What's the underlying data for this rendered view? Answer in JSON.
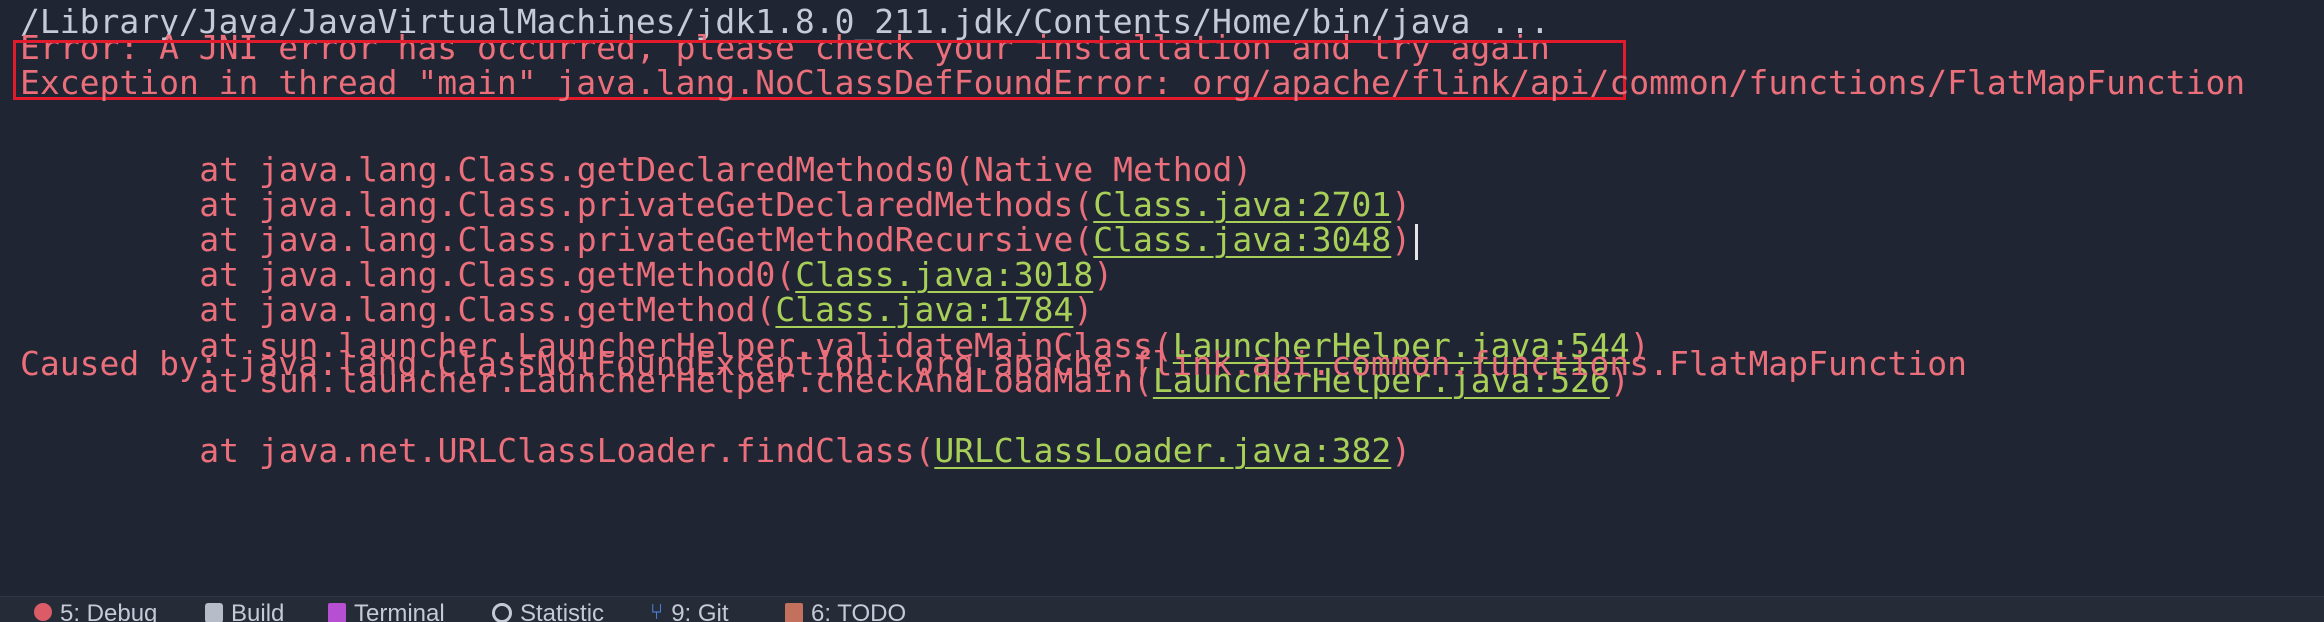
{
  "console": {
    "command_line": "/Library/Java/JavaVirtualMachines/jdk1.8.0_211.jdk/Contents/Home/bin/java ...",
    "error_line": "Error: A JNI error has occurred, please check your installation and try again",
    "exception_line": "Exception in thread \"main\" java.lang.NoClassDefFoundError: org/apache/flink/api/common/functions/FlatMapFunction",
    "frames": [
      {
        "prefix": "at java.lang.Class.getDeclaredMethods0(Native Method)",
        "link": "",
        "suffix": ""
      },
      {
        "prefix": "at java.lang.Class.privateGetDeclaredMethods(",
        "link": "Class.java:2701",
        "suffix": ")"
      },
      {
        "prefix": "at java.lang.Class.privateGetMethodRecursive(",
        "link": "Class.java:3048",
        "suffix": ")"
      },
      {
        "prefix": "at java.lang.Class.getMethod0(",
        "link": "Class.java:3018",
        "suffix": ")"
      },
      {
        "prefix": "at java.lang.Class.getMethod(",
        "link": "Class.java:1784",
        "suffix": ")"
      },
      {
        "prefix": "at sun.launcher.LauncherHelper.validateMainClass(",
        "link": "LauncherHelper.java:544",
        "suffix": ")"
      },
      {
        "prefix": "at sun.launcher.LauncherHelper.checkAndLoadMain(",
        "link": "LauncherHelper.java:526",
        "suffix": ")"
      }
    ],
    "caused_by_line": "Caused by: java.lang.ClassNotFoundException: org.apache.flink.api.common.functions.FlatMapFunction",
    "partial_frame": {
      "prefix": "at java.net.URLClassLoader.findClass(",
      "link": "URLClassLoader.java:382",
      "suffix": ")"
    }
  },
  "statusbar": {
    "tools": [
      {
        "label": "5: Debug",
        "icon": "debug-icon"
      },
      {
        "label": "Build",
        "icon": "build-icon"
      },
      {
        "label": "Terminal",
        "icon": "terminal-icon"
      },
      {
        "label": "Statistic",
        "icon": "statistic-icon"
      },
      {
        "label": "9: Git",
        "icon": "git-icon"
      },
      {
        "label": "6: TODO",
        "icon": "todo-icon"
      }
    ]
  },
  "colors": {
    "background": "#1f2533",
    "error_text": "#ea6f7b",
    "link_text": "#a8cf57",
    "command_text": "#c5cad6",
    "highlight_box": "#e11b2b"
  }
}
